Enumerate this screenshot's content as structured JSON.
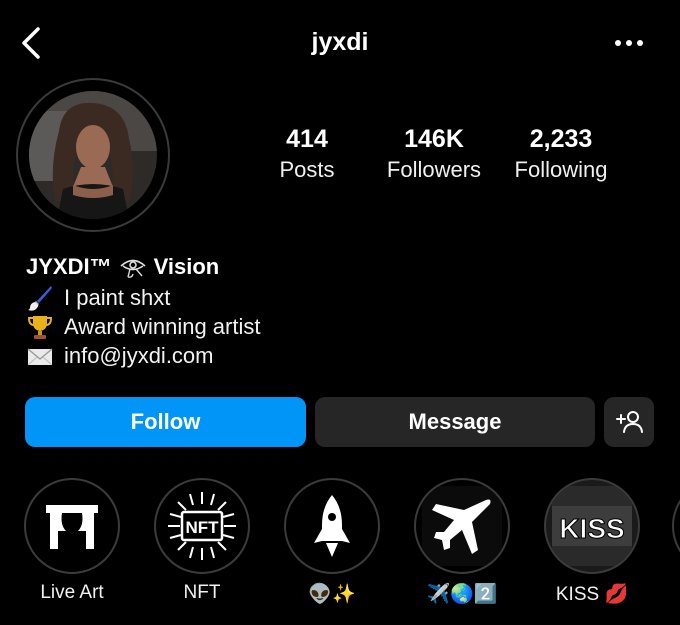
{
  "header": {
    "username": "jyxdi",
    "back_icon": "chevron-left-icon",
    "more_icon": "more-horizontal-icon"
  },
  "stats": [
    {
      "value": "414",
      "label": "Posts"
    },
    {
      "value": "146K",
      "label": "Followers"
    },
    {
      "value": "2,233",
      "label": "Following"
    }
  ],
  "bio": {
    "name": "JYXDI™",
    "name_suffix": "Vision",
    "lines": [
      {
        "icon": "paintbrush-icon",
        "text": "I paint shxt"
      },
      {
        "icon": "trophy-icon",
        "text": "Award winning artist"
      },
      {
        "icon": "envelope-icon",
        "text": "info@jyxdi.com"
      }
    ]
  },
  "actions": {
    "follow_label": "Follow",
    "message_label": "Message",
    "add_icon": "add-person-icon"
  },
  "highlights": [
    {
      "label": "Live Art",
      "icon": "theater-curtain-icon"
    },
    {
      "label": "NFT",
      "icon": "nft-chip-icon"
    },
    {
      "label": "👽✨",
      "icon": "rocket-icon"
    },
    {
      "label": "✈️🌏2️⃣",
      "icon": "airplane-icon"
    },
    {
      "label": "KISS 💋",
      "icon": "kiss-logo-icon"
    }
  ],
  "colors": {
    "background": "#000000",
    "follow_button": "#0095f6",
    "secondary_button": "#262626"
  }
}
